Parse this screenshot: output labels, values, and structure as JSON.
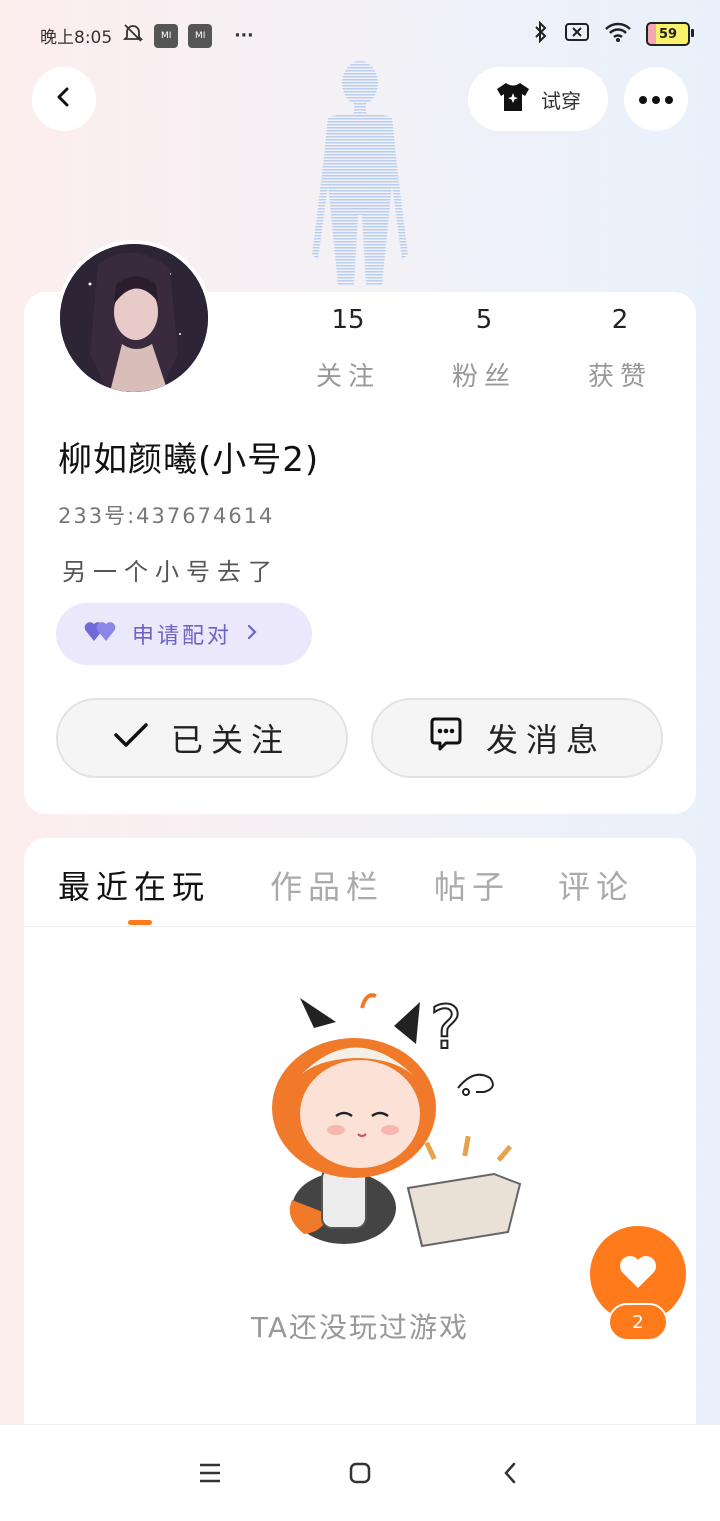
{
  "status_bar": {
    "time": "晚上8:05",
    "more": "···",
    "battery": "59"
  },
  "header": {
    "tryon_label": "试穿"
  },
  "profile": {
    "nickname": "柳如颜曦(小号2)",
    "uid": "233号:437674614",
    "bio": "另一个小号去了",
    "pair_label": "申请配对",
    "stats": [
      {
        "value": "15",
        "label": "关注"
      },
      {
        "value": "5",
        "label": "粉丝"
      },
      {
        "value": "2",
        "label": "获赞"
      }
    ],
    "follow_label": "已关注",
    "message_label": "发消息"
  },
  "tabs": [
    {
      "label": "最近在玩",
      "active": true
    },
    {
      "label": "作品栏",
      "active": false
    },
    {
      "label": "帖子",
      "active": false
    },
    {
      "label": "评论",
      "active": false
    }
  ],
  "empty_state": {
    "text": "TA还没玩过游戏"
  },
  "like": {
    "count": "2"
  },
  "colors": {
    "accent": "#ff7a1a",
    "pair_bg": "#ebe8fb",
    "pair_text": "#6c64c5"
  }
}
